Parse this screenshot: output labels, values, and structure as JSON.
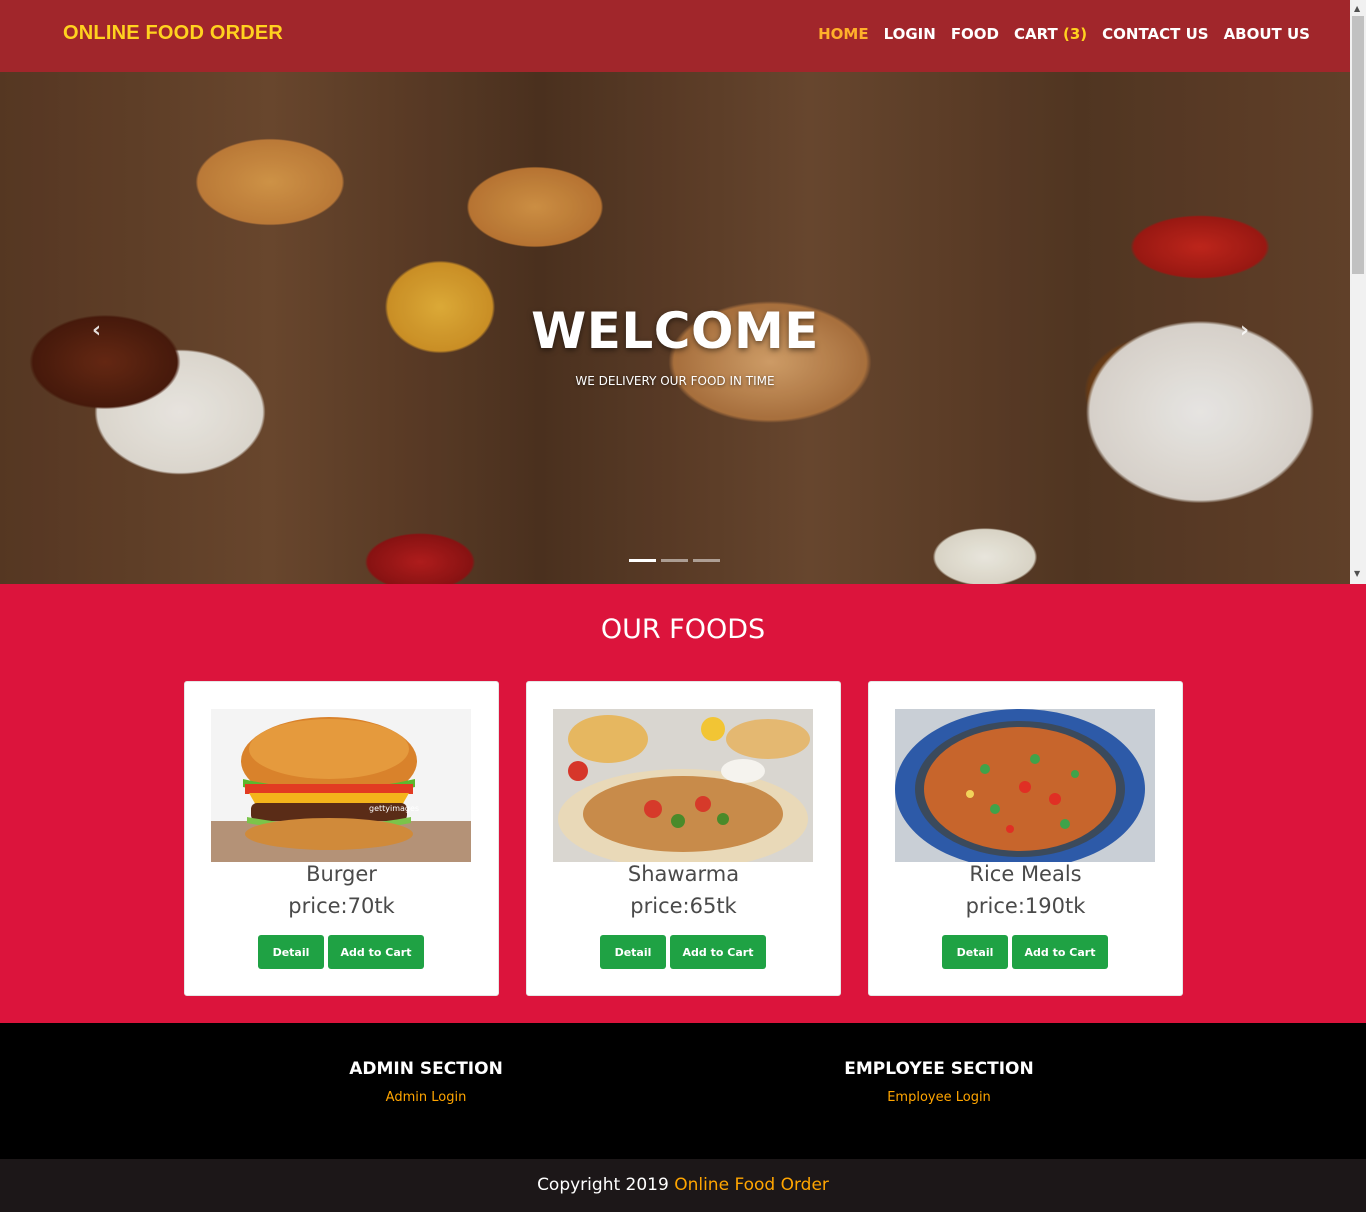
{
  "navbar": {
    "brand": "ONLINE FOOD ORDER",
    "items": [
      {
        "label": "HOME",
        "active": true
      },
      {
        "label": "LOGIN"
      },
      {
        "label": "FOOD"
      },
      {
        "label": "CART"
      },
      {
        "label": "CONTACT US"
      },
      {
        "label": "ABOUT US"
      }
    ],
    "cart_count": "(3)"
  },
  "hero": {
    "title": "WELCOME",
    "subtitle": "WE DELIVERY OUR FOOD IN TIME",
    "prev_icon": "‹",
    "next_icon": "›",
    "slides_count": 3,
    "active_slide": 1
  },
  "foods": {
    "title": "OUR FOODS",
    "items": [
      {
        "name": "Burger",
        "price": "price:70tk",
        "detail_label": "Detail",
        "cart_label": "Add to Cart"
      },
      {
        "name": "Shawarma",
        "price": "price:65tk",
        "detail_label": "Detail",
        "cart_label": "Add to Cart"
      },
      {
        "name": "Rice Meals",
        "price": "price:190tk",
        "detail_label": "Detail",
        "cart_label": "Add to Cart"
      }
    ]
  },
  "sections": {
    "admin_title": "ADMIN SECTION",
    "admin_link": "Admin Login",
    "employee_title": "EMPLOYEE SECTION",
    "employee_link": "Employee Login"
  },
  "footer": {
    "copyright_prefix": "Copyright 2019 ",
    "copyright_brand": "Online Food Order"
  },
  "colors": {
    "navbar": "#a1262b",
    "brand": "#ffd21f",
    "active_nav": "#ffb02a",
    "foods_bg": "#dc143c",
    "button": "#1fa244",
    "link": "#ffa500"
  }
}
